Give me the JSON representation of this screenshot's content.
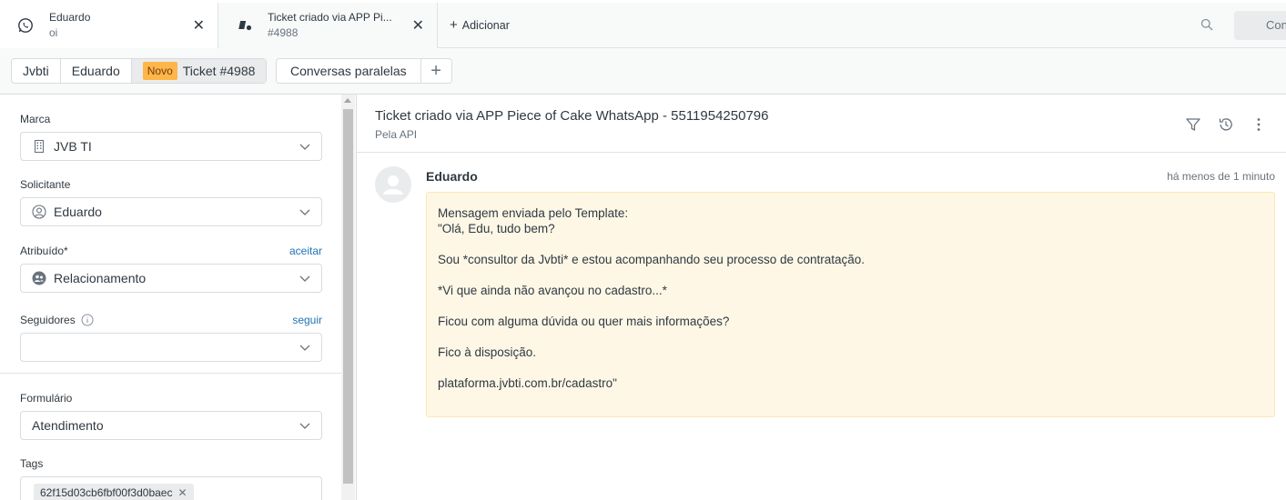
{
  "tabs": [
    {
      "title": "Eduardo",
      "subtitle": "oi",
      "icon": "whatsapp-icon"
    },
    {
      "title": "Ticket criado via APP Pi...",
      "subtitle": "#4988",
      "icon": "ticket-icon"
    }
  ],
  "add_tab_label": "Adicionar",
  "top_button_label": "Con",
  "breadcrumb": {
    "items": [
      "Jvbti",
      "Eduardo"
    ],
    "status_badge": "Novo",
    "ticket": "Ticket #4988"
  },
  "side_conversations_label": "Conversas paralelas",
  "sidebar": {
    "brand": {
      "label": "Marca",
      "value": "JVB TI"
    },
    "requester": {
      "label": "Solicitante",
      "value": "Eduardo"
    },
    "assignee": {
      "label": "Atribuído*",
      "action": "aceitar",
      "value": "Relacionamento"
    },
    "followers": {
      "label": "Seguidores",
      "action": "seguir",
      "value": ""
    },
    "form": {
      "label": "Formulário",
      "value": "Atendimento"
    },
    "tags": {
      "label": "Tags",
      "values": [
        "62f15d03cb6fbf00f3d0baec"
      ]
    }
  },
  "conversation": {
    "title": "Ticket criado via APP Piece of Cake WhatsApp - 5511954250796",
    "subtitle": "Pela API",
    "message": {
      "author": "Eduardo",
      "time": "há menos de 1 minuto",
      "lines": [
        "Mensagem enviada pelo Template:",
        "\"Olá, Edu, tudo bem?",
        "",
        "Sou *consultor da Jvbti* e estou acompanhando seu processo de contratação.",
        "",
        "*Vi que ainda não avançou no cadastro...*",
        "",
        "Ficou com alguma dúvida ou quer mais informações?",
        "",
        "Fico à disposição.",
        "",
        "plataforma.jvbti.com.br/cadastro\""
      ]
    }
  },
  "colors": {
    "accent": "#1f73b7",
    "new_badge": "#ffb648",
    "message_bg": "#fef7e6"
  }
}
